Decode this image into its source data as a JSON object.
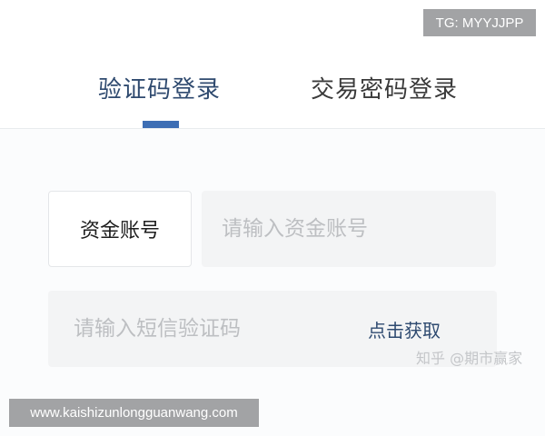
{
  "watermarks": {
    "tg": "TG: MYYJJPP",
    "site": "www.kaishizunlongguanwang.com",
    "zhihu": "知乎 @期市赢家"
  },
  "tabs": [
    {
      "label": "验证码登录",
      "active": true
    },
    {
      "label": "交易密码登录",
      "active": false
    }
  ],
  "form": {
    "account_label": "资金账号",
    "account_placeholder": "请输入资金账号",
    "account_value": "",
    "sms_placeholder": "请输入短信验证码",
    "sms_value": "",
    "get_code_label": "点击获取"
  },
  "colors": {
    "active_tab": "#2f4a6f",
    "tab_indicator": "#3d6eb4",
    "inactive_tab": "#3a3a3a",
    "input_bg": "#f3f4f5",
    "placeholder": "#bdbfc2",
    "watermark_bg": "#a2a3a5"
  }
}
